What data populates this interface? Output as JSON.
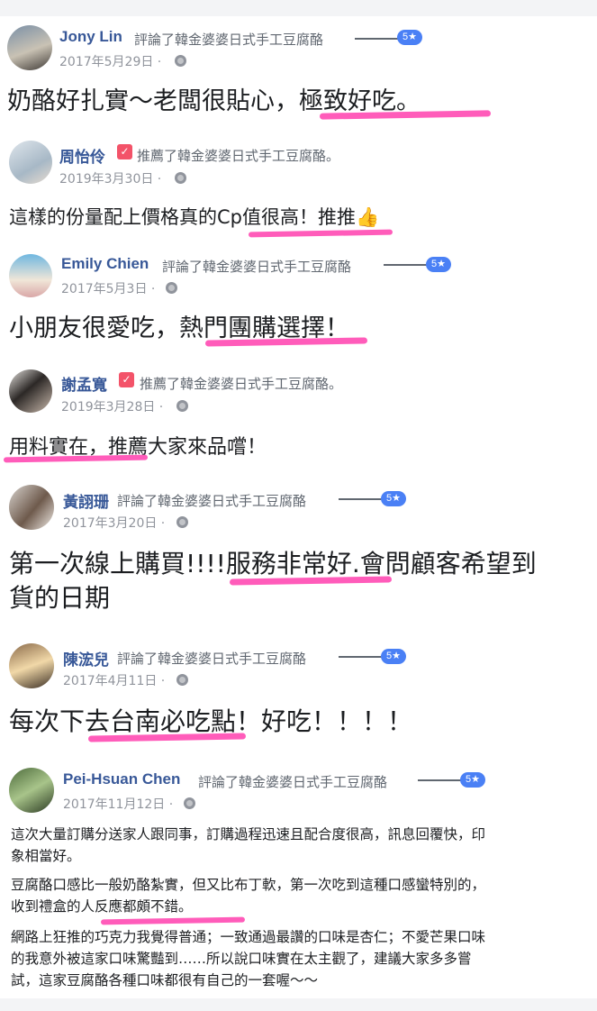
{
  "reviews": [
    {
      "name": "Jony Lin",
      "action": "評論了韓金婆婆日式手工豆腐酪",
      "rating": "5★",
      "date": "2017年5月29日 ·",
      "text": "奶酪好扎實～老闆很貼心，極致好吃。",
      "avatar_colors": [
        "#7a8fa6",
        "#c9c2b4",
        "#3f3a36"
      ]
    },
    {
      "name": "周怡伶",
      "action": "推薦了韓金婆婆日式手工豆腐酪。",
      "date": "2019年3月30日 ·",
      "text": "這樣的份量配上價格真的Cp值很高！推推👍",
      "avatar_colors": [
        "#dfe6ec",
        "#a7b8c6",
        "#e8dcd0"
      ]
    },
    {
      "name": "Emily Chien",
      "action": "評論了韓金婆婆日式手工豆腐酪",
      "rating": "5★",
      "date": "2017年5月3日 ·",
      "text": "小朋友很愛吃，熱門團購選擇！",
      "avatar_colors": [
        "#6fb7e0",
        "#f0e6d8",
        "#d9a7a7"
      ]
    },
    {
      "name": "謝孟寬",
      "action": "推薦了韓金婆婆日式手工豆腐酪。",
      "date": "2019年3月28日 ·",
      "text": "用料實在，推薦大家來品嚐！",
      "avatar_colors": [
        "#e6e3df",
        "#2c2826",
        "#c9b9ac"
      ]
    },
    {
      "name": "黃詡珊",
      "action": "評論了韓金婆婆日式手工豆腐酪",
      "rating": "5★",
      "date": "2017年3月20日 ·",
      "text_lines": [
        "第一次線上購買!!!!服務非常好.會問顧客希望到",
        "貨的日期"
      ],
      "avatar_colors": [
        "#d8d3ce",
        "#6e5a4c",
        "#f2ede8"
      ]
    },
    {
      "name": "陳浤兒",
      "action": "評論了韓金婆婆日式手工豆腐酪",
      "rating": "5★",
      "date": "2017年4月11日 ·",
      "text": "每次下去台南必吃點！好吃！！！！",
      "avatar_colors": [
        "#8a6a4a",
        "#f1d8a8",
        "#3a2e24"
      ]
    },
    {
      "name": "Pei-Hsuan Chen",
      "action": "評論了韓金婆婆日式手工豆腐酪",
      "rating": "5★",
      "date": "2017年11月12日 ·",
      "paragraphs": [
        [
          "這次大量訂購分送家人跟同事，訂購過程迅速且配合度很高，訊息回覆快，印",
          "象相當好。"
        ],
        [
          "豆腐酪口感比一般奶酪紮實，但又比布丁軟，第一次吃到這種口感蠻特別的，",
          "收到禮盒的人反應都頗不錯。"
        ],
        [
          "網路上狂推的巧克力我覺得普通；一致通過最讚的口味是杏仁；不愛芒果口味",
          "的我意外被這家口味驚豔到……所以說口味實在太主觀了，建議大家多多嘗",
          "試，這家豆腐酪各種口味都很有自己的一套喔～～"
        ]
      ],
      "avatar_colors": [
        "#4d6b3c",
        "#a8c48a",
        "#2b3a22"
      ]
    }
  ],
  "colors": {
    "name_link": "#385898",
    "meta_gray": "#606770",
    "badge_blue": "#4a80f5",
    "highlight_pink": "#ff3fae"
  }
}
